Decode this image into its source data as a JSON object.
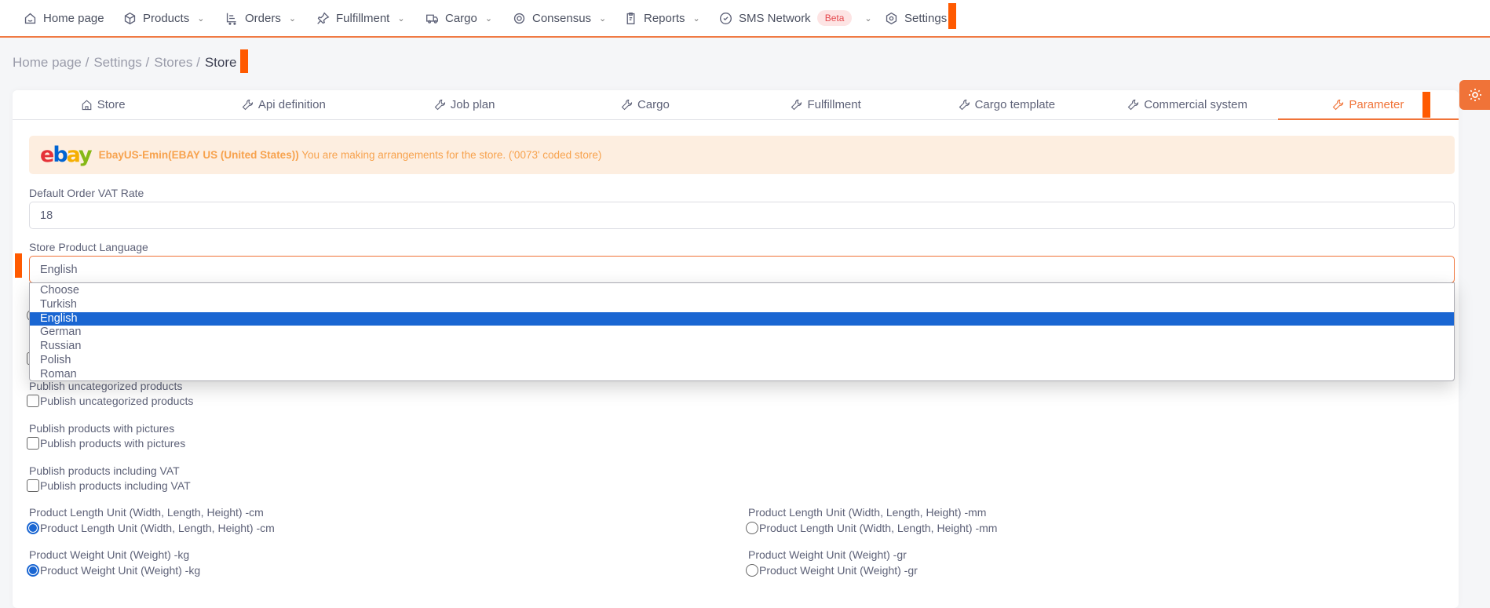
{
  "nav": {
    "items": [
      {
        "label": "Home page",
        "icon": "home-icon",
        "dropdown": false
      },
      {
        "label": "Products",
        "icon": "box-icon",
        "dropdown": true
      },
      {
        "label": "Orders",
        "icon": "cart-icon",
        "dropdown": true
      },
      {
        "label": "Fulfillment",
        "icon": "pin-icon",
        "dropdown": true
      },
      {
        "label": "Cargo",
        "icon": "truck-icon",
        "dropdown": true
      },
      {
        "label": "Consensus",
        "icon": "target-icon",
        "dropdown": true
      },
      {
        "label": "Reports",
        "icon": "clipboard-icon",
        "dropdown": true
      },
      {
        "label": "SMS Network",
        "icon": "check-circle-icon",
        "dropdown": true,
        "badge": "Beta"
      },
      {
        "label": "Settings",
        "icon": "hexagon-gear-icon",
        "dropdown": false
      }
    ]
  },
  "breadcrumb": [
    "Home page",
    "Settings",
    "Stores",
    "Store"
  ],
  "tabs": [
    {
      "label": "Store",
      "icon": "home-icon"
    },
    {
      "label": "Api definition",
      "icon": "wrench-icon"
    },
    {
      "label": "Job plan",
      "icon": "wrench-icon"
    },
    {
      "label": "Cargo",
      "icon": "wrench-icon"
    },
    {
      "label": "Fulfillment",
      "icon": "wrench-icon"
    },
    {
      "label": "Cargo template",
      "icon": "wrench-icon"
    },
    {
      "label": "Commercial system",
      "icon": "wrench-icon"
    },
    {
      "label": "Parameter",
      "icon": "wrench-icon",
      "active": true
    }
  ],
  "alert": {
    "logo": "ebay",
    "store": "EbayUS-Emin(EBAY US (United States))",
    "message": "You are making arrangements for the store. ('0073' coded store)"
  },
  "form": {
    "vat_label": "Default Order VAT Rate",
    "vat_value": "18",
    "lang_label": "Store Product Language",
    "lang_value": "English",
    "lang_options": [
      "Choose",
      "Turkish",
      "English",
      "German",
      "Russian",
      "Polish",
      "Roman"
    ],
    "uncat_label": "Publish uncategorized products",
    "uncat_check": "Publish uncategorized products",
    "pics_label": "Publish products with pictures",
    "pics_check": "Publish products with pictures",
    "vatinc_label": "Publish products including VAT",
    "vatinc_check": "Publish products including VAT",
    "len_cm_label": "Product Length Unit (Width, Length, Height) -cm",
    "len_cm_radio": "Product Length Unit (Width, Length, Height) -cm",
    "len_mm_label": "Product Length Unit (Width, Length, Height) -mm",
    "len_mm_radio": "Product Length Unit (Width, Length, Height) -mm",
    "wt_kg_label": "Product Weight Unit (Weight) -kg",
    "wt_kg_radio": "Product Weight Unit (Weight) -kg",
    "wt_gr_label": "Product Weight Unit (Weight) -gr",
    "wt_gr_radio": "Product Weight Unit (Weight) -gr"
  },
  "colors": {
    "accent": "#f07338",
    "highlight": "#1a66d2",
    "alert_bg": "#fdeee0",
    "alert_text": "#f7a24d",
    "marker": "#ff5a00"
  }
}
